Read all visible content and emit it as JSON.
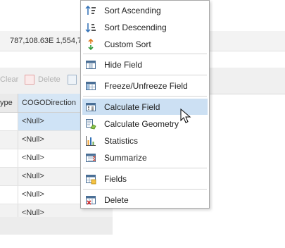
{
  "coord_bar": {
    "text": "787,108.63E 1,554,7"
  },
  "toolbar": {
    "clear_label": "Clear",
    "delete_label": "Delete"
  },
  "grid": {
    "columns": [
      {
        "label": "ype"
      },
      {
        "label": "COGODirection"
      }
    ],
    "rows": [
      {
        "value": "<Null>"
      },
      {
        "value": "<Null>"
      },
      {
        "value": "<Null>"
      },
      {
        "value": "<Null>"
      },
      {
        "value": "<Null>"
      },
      {
        "value": "<Null>"
      }
    ]
  },
  "menu": {
    "items": [
      {
        "label": "Sort Ascending",
        "icon": "sort-ascending-icon"
      },
      {
        "label": "Sort Descending",
        "icon": "sort-descending-icon"
      },
      {
        "label": "Custom Sort",
        "icon": "custom-sort-icon"
      },
      {
        "label": "Hide Field",
        "icon": "hide-field-icon"
      },
      {
        "label": "Freeze/Unfreeze Field",
        "icon": "freeze-field-icon"
      },
      {
        "label": "Calculate Field",
        "icon": "calculate-field-icon",
        "highlighted": true
      },
      {
        "label": "Calculate Geometry",
        "icon": "calculate-geometry-icon"
      },
      {
        "label": "Statistics",
        "icon": "statistics-icon"
      },
      {
        "label": "Summarize",
        "icon": "summarize-icon"
      },
      {
        "label": "Fields",
        "icon": "fields-icon"
      },
      {
        "label": "Delete",
        "icon": "delete-field-icon"
      }
    ]
  },
  "colors": {
    "highlight": "#cce0f3",
    "selected_cell": "#cfe3f6",
    "accent_blue": "#2f6fb5"
  }
}
